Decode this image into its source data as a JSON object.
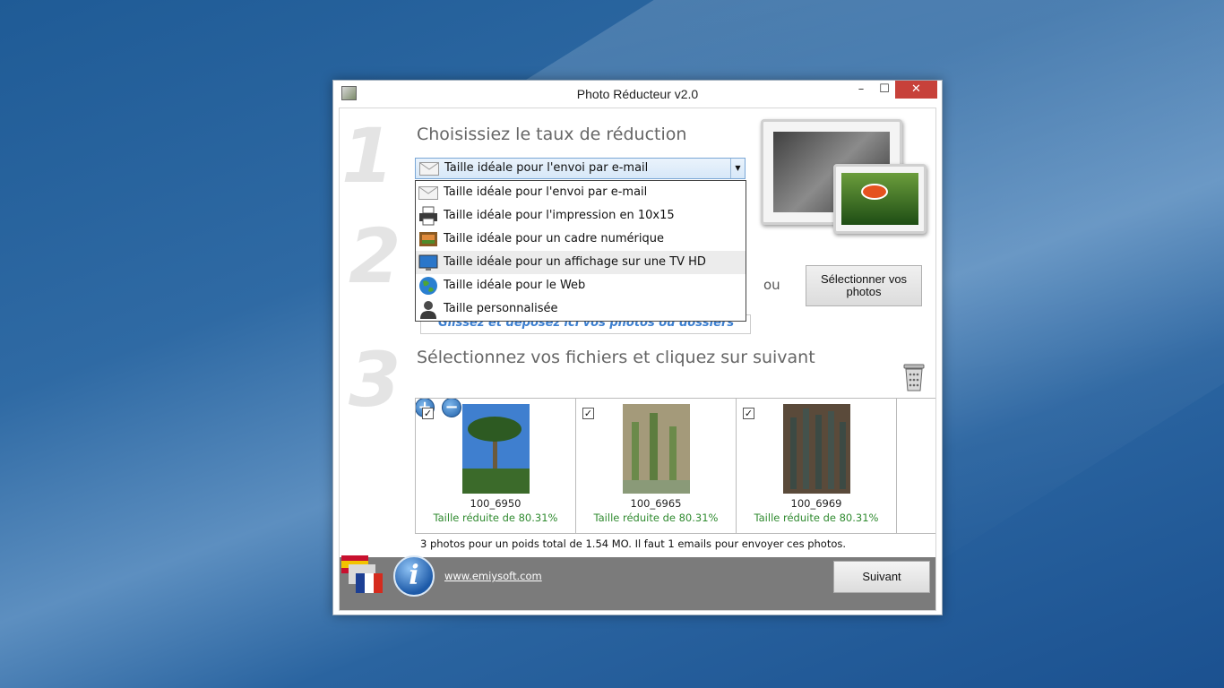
{
  "window": {
    "title": "Photo Réducteur v2.0",
    "minimize": "–",
    "maximize": "☐",
    "close": "✕"
  },
  "steps": {
    "one": "1",
    "two": "2",
    "three": "3"
  },
  "section1": {
    "heading": "Choisissiez le taux de réduction",
    "selected": "Taille idéale pour l'envoi par e-mail",
    "options": [
      {
        "label": "Taille idéale pour l'envoi par e-mail",
        "icon": "envelope-icon"
      },
      {
        "label": "Taille idéale pour l'impression en 10x15",
        "icon": "printer-icon"
      },
      {
        "label": "Taille idéale pour un cadre numérique",
        "icon": "picture-frame-icon"
      },
      {
        "label": "Taille idéale pour un affichage sur une TV HD",
        "icon": "monitor-icon"
      },
      {
        "label": "Taille idéale pour le Web",
        "icon": "globe-icon"
      },
      {
        "label": "Taille personnalisée",
        "icon": "person-icon"
      }
    ]
  },
  "section2": {
    "drop_text": "Glissez et déposez ici vos photos ou dossiers",
    "or": "ou",
    "select_button_line1": "Sélectionner vos",
    "select_button_line2": "photos"
  },
  "section3": {
    "heading": "Sélectionnez vos fichiers et cliquez sur suivant",
    "files": [
      {
        "name": "100_6950",
        "reduction": "Taille réduite de 80.31%",
        "checked": true
      },
      {
        "name": "100_6965",
        "reduction": "Taille réduite de 80.31%",
        "checked": true
      },
      {
        "name": "100_6969",
        "reduction": "Taille réduite de 80.31%",
        "checked": true
      }
    ],
    "summary": "3 photos pour un poids total de 1.54 MO. Il faut 1 emails pour envoyer ces photos."
  },
  "footer": {
    "site": "www.emiysoft.com",
    "next": "Suivant",
    "info": "i"
  }
}
